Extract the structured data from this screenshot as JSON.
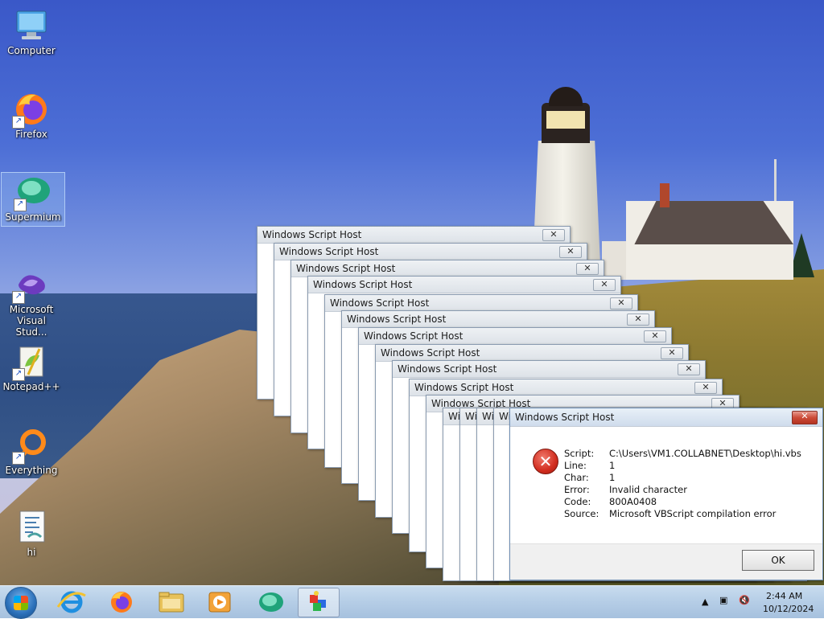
{
  "desktop": {
    "icons": [
      {
        "label": "Computer"
      },
      {
        "label": "Firefox"
      },
      {
        "label": "Supermium"
      },
      {
        "label": "Microsoft Visual Stud..."
      },
      {
        "label": "Notepad++"
      },
      {
        "label": "Everything"
      },
      {
        "label": "hi"
      }
    ]
  },
  "windows": {
    "stack_title": "Windows Script Host",
    "partial_title": "Wi",
    "close_glyph": "✕"
  },
  "dialog": {
    "title": "Windows Script Host",
    "fields": [
      {
        "key": "Script:",
        "value": "C:\\Users\\VM1.COLLABNET\\Desktop\\hi.vbs"
      },
      {
        "key": "Line:",
        "value": "1"
      },
      {
        "key": "Char:",
        "value": "1"
      },
      {
        "key": "Error:",
        "value": "Invalid character"
      },
      {
        "key": "Code:",
        "value": "800A0408"
      },
      {
        "key": "Source:",
        "value": "Microsoft VBScript compilation error"
      }
    ],
    "ok_label": "OK"
  },
  "taskbar": {
    "pinned": [
      "internet-explorer-icon",
      "firefox-icon",
      "file-explorer-icon",
      "media-player-icon",
      "supermium-icon",
      "script-host-icon"
    ],
    "time": "2:44 AM",
    "date": "10/12/2024"
  }
}
